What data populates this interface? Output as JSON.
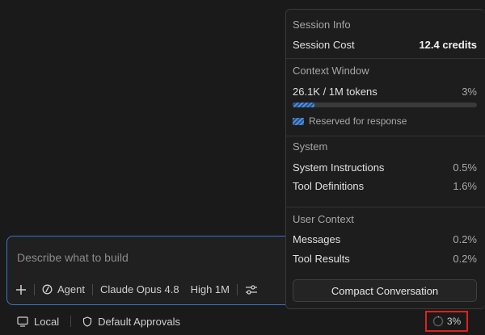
{
  "composer": {
    "placeholder": "Describe what to build",
    "mode_label": "Agent",
    "model_label": "Claude Opus 4.8",
    "effort_label": "High 1M"
  },
  "statusbar": {
    "local_label": "Local",
    "approvals_label": "Default Approvals",
    "context_percent": "3%"
  },
  "session_panel": {
    "session_info": {
      "title": "Session Info",
      "cost_label": "Session Cost",
      "cost_value": "12.4 credits"
    },
    "context_window": {
      "title": "Context Window",
      "tokens_label": "26.1K / 1M tokens",
      "percent_label": "3%",
      "usage_fraction": 0.03,
      "reserved_fraction": 0.09,
      "legend_label": "Reserved for response"
    },
    "system": {
      "title": "System",
      "items": [
        {
          "label": "System Instructions",
          "value": "0.5%"
        },
        {
          "label": "Tool Definitions",
          "value": "1.6%"
        }
      ]
    },
    "user_context": {
      "title": "User Context",
      "items": [
        {
          "label": "Messages",
          "value": "0.2%"
        },
        {
          "label": "Tool Results",
          "value": "0.2%"
        }
      ]
    },
    "compact_button_label": "Compact Conversation"
  },
  "colors": {
    "accent": "#3b74c4",
    "progress_fill": "#4a8fe0",
    "highlight_box": "#e02020"
  }
}
